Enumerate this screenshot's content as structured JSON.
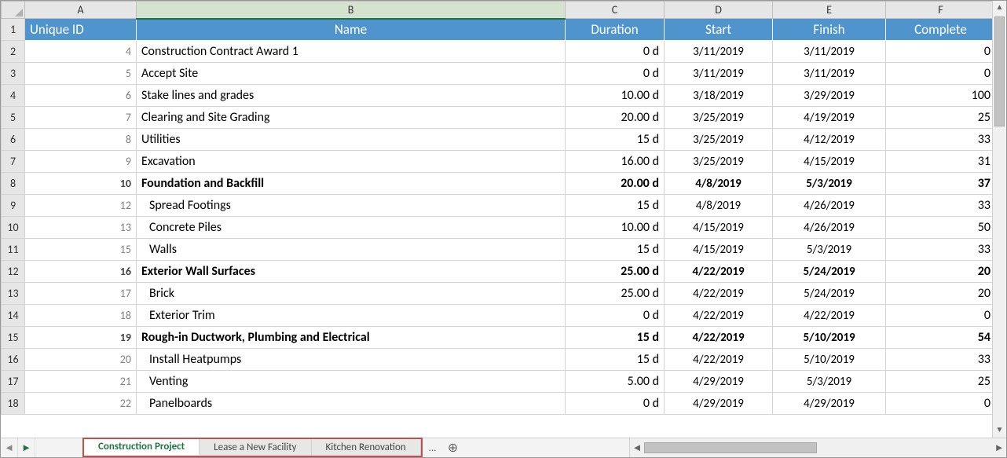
{
  "columns": [
    "A",
    "B",
    "C",
    "D",
    "E",
    "F"
  ],
  "column_selected": "B",
  "header_row": {
    "unique_id": "Unique ID",
    "name": "Name",
    "duration": "Duration",
    "start": "Start",
    "finish": "Finish",
    "complete": "Complete"
  },
  "rows": [
    {
      "num": 2,
      "id": "4",
      "name": "Construction Contract Award 1",
      "dur": "0 d",
      "start": "3/11/2019",
      "finish": "3/11/2019",
      "comp": "0",
      "bold": false,
      "indent": 0
    },
    {
      "num": 3,
      "id": "5",
      "name": "Accept Site",
      "dur": "0 d",
      "start": "3/11/2019",
      "finish": "3/11/2019",
      "comp": "0",
      "bold": false,
      "indent": 0
    },
    {
      "num": 4,
      "id": "6",
      "name": "Stake lines and grades",
      "dur": "10.00 d",
      "start": "3/18/2019",
      "finish": "3/29/2019",
      "comp": "100",
      "bold": false,
      "indent": 0
    },
    {
      "num": 5,
      "id": "7",
      "name": "Clearing and Site Grading",
      "dur": "20.00 d",
      "start": "3/25/2019",
      "finish": "4/19/2019",
      "comp": "25",
      "bold": false,
      "indent": 0
    },
    {
      "num": 6,
      "id": "8",
      "name": "Utilities",
      "dur": "15 d",
      "start": "3/25/2019",
      "finish": "4/12/2019",
      "comp": "33",
      "bold": false,
      "indent": 0
    },
    {
      "num": 7,
      "id": "9",
      "name": "Excavation",
      "dur": "16.00 d",
      "start": "3/25/2019",
      "finish": "4/15/2019",
      "comp": "31",
      "bold": false,
      "indent": 0
    },
    {
      "num": 8,
      "id": "10",
      "name": "Foundation and Backfill",
      "dur": "20.00 d",
      "start": "4/8/2019",
      "finish": "5/3/2019",
      "comp": "37",
      "bold": true,
      "indent": 0
    },
    {
      "num": 9,
      "id": "12",
      "name": "Spread Footings",
      "dur": "15 d",
      "start": "4/8/2019",
      "finish": "4/26/2019",
      "comp": "33",
      "bold": false,
      "indent": 1
    },
    {
      "num": 10,
      "id": "13",
      "name": "Concrete Piles",
      "dur": "10.00 d",
      "start": "4/15/2019",
      "finish": "4/26/2019",
      "comp": "50",
      "bold": false,
      "indent": 1
    },
    {
      "num": 11,
      "id": "15",
      "name": "Walls",
      "dur": "15 d",
      "start": "4/15/2019",
      "finish": "5/3/2019",
      "comp": "33",
      "bold": false,
      "indent": 1
    },
    {
      "num": 12,
      "id": "16",
      "name": "Exterior Wall Surfaces",
      "dur": "25.00 d",
      "start": "4/22/2019",
      "finish": "5/24/2019",
      "comp": "20",
      "bold": true,
      "indent": 0
    },
    {
      "num": 13,
      "id": "17",
      "name": "Brick",
      "dur": "25.00 d",
      "start": "4/22/2019",
      "finish": "5/24/2019",
      "comp": "20",
      "bold": false,
      "indent": 1
    },
    {
      "num": 14,
      "id": "18",
      "name": "Exterior Trim",
      "dur": "0 d",
      "start": "4/22/2019",
      "finish": "4/22/2019",
      "comp": "0",
      "bold": false,
      "indent": 1
    },
    {
      "num": 15,
      "id": "19",
      "name": "Rough-in Ductwork, Plumbing and Electrical",
      "dur": "15 d",
      "start": "4/22/2019",
      "finish": "5/10/2019",
      "comp": "54",
      "bold": true,
      "indent": 0
    },
    {
      "num": 16,
      "id": "20",
      "name": "Install Heatpumps",
      "dur": "15 d",
      "start": "4/22/2019",
      "finish": "5/10/2019",
      "comp": "33",
      "bold": false,
      "indent": 1
    },
    {
      "num": 17,
      "id": "21",
      "name": "Venting",
      "dur": "5.00 d",
      "start": "4/29/2019",
      "finish": "5/3/2019",
      "comp": "25",
      "bold": false,
      "indent": 1
    },
    {
      "num": 18,
      "id": "22",
      "name": "Panelboards",
      "dur": "0 d",
      "start": "4/29/2019",
      "finish": "4/29/2019",
      "comp": "0",
      "bold": false,
      "indent": 1
    }
  ],
  "tabs": [
    {
      "label": "Construction Project",
      "active": true
    },
    {
      "label": "Lease a New Facility",
      "active": false
    },
    {
      "label": "Kitchen Renovation",
      "active": false
    }
  ],
  "tab_overflow": "..."
}
